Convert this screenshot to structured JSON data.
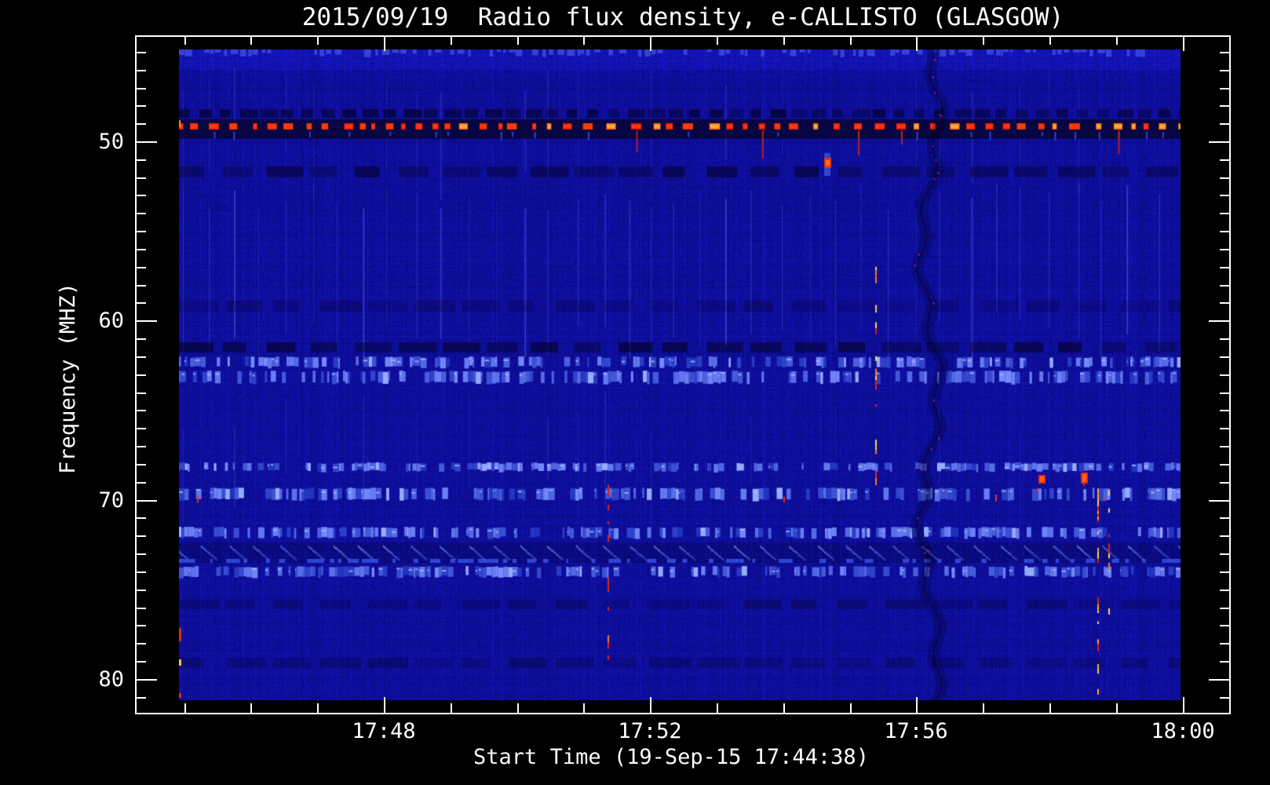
{
  "chart_data": {
    "type": "heatmap",
    "subtype": "radio-spectrogram",
    "title": "2015/09/19  Radio flux density, e-CALLISTO (GLASGOW)",
    "xlabel": "Start Time (19-Sep-15 17:44:38)",
    "ylabel": "Frequency (MHZ)",
    "x_axis": {
      "start_time": "17:44:38",
      "end_time": "18:00:00",
      "minor_tick_step_seconds": 60,
      "first_minor_tick": "17:45",
      "minor_tick_count": 16,
      "major_every_nth": 4,
      "major_labels": [
        "17:48",
        "17:52",
        "17:56",
        "18:00"
      ]
    },
    "y_axis": {
      "unit": "MHz",
      "orientation": "inverted-low-at-top",
      "minor_tick_min": 45,
      "minor_tick_max": 81,
      "minor_tick_step": 1,
      "major_values": [
        50,
        60,
        70,
        80
      ],
      "major_labels": [
        "50",
        "60",
        "70",
        "80"
      ],
      "data_freq_range_mhz": [
        44.9,
        81.3
      ]
    },
    "colormap": {
      "background_low": "#05056e",
      "background_mid": "#0a0a8c",
      "background_high": "#2a3cd2",
      "rfi_strong": "#ff2a00",
      "rfi_saturated": "#ffd24a",
      "frame_and_text": "#ffffff",
      "page_background": "#000000"
    },
    "rfi_bands": [
      {
        "freq_mhz": [
          48.2,
          48.7
        ],
        "type": "dark-dashed"
      },
      {
        "freq_mhz": [
          48.9,
          49.4
        ],
        "type": "strong-red-dashed"
      },
      {
        "freq_mhz": [
          49.5,
          49.9
        ],
        "type": "blue-ticks"
      },
      {
        "freq_mhz": [
          51.4,
          52.0
        ],
        "type": "dark-blocks"
      },
      {
        "freq_mhz": [
          58.9,
          59.5
        ],
        "type": "faint-dark"
      },
      {
        "freq_mhz": [
          61.2,
          61.8
        ],
        "type": "dark-blocks"
      },
      {
        "freq_mhz": [
          62.0,
          62.6
        ],
        "type": "bright-dashed"
      },
      {
        "freq_mhz": [
          62.8,
          63.5
        ],
        "type": "bright-dashed"
      },
      {
        "freq_mhz": [
          67.9,
          68.4
        ],
        "type": "bright-dashed"
      },
      {
        "freq_mhz": [
          69.3,
          70.0
        ],
        "type": "bright-dashed-red"
      },
      {
        "freq_mhz": [
          71.5,
          72.1
        ],
        "type": "bright-dashed"
      },
      {
        "freq_mhz": [
          72.4,
          73.5
        ],
        "type": "diagonal-comb"
      },
      {
        "freq_mhz": [
          73.7,
          74.3
        ],
        "type": "bright-dashed"
      },
      {
        "freq_mhz": [
          75.6,
          76.1
        ],
        "type": "faint-dark"
      },
      {
        "freq_mhz": [
          78.8,
          79.4
        ],
        "type": "faint-dark"
      }
    ],
    "events": [
      {
        "time": "17:51:22",
        "freq_mhz": [
          68.8,
          79.4
        ],
        "type": "red-dashed-streak"
      },
      {
        "time": "17:54:40",
        "freq_mhz": [
          50.9,
          51.4
        ],
        "type": "point-burst"
      },
      {
        "time": "17:55:23",
        "freq_mhz": [
          57.0,
          70.2
        ],
        "type": "orange-dashed-streak"
      },
      {
        "time": "17:56:12",
        "freq_mhz": [
          44.9,
          81.3
        ],
        "type": "dark-disturbance-column"
      },
      {
        "time": "17:57:53",
        "freq_mhz": [
          68.6,
          69.1
        ],
        "type": "red-blob"
      },
      {
        "time": "17:58:31",
        "freq_mhz": [
          68.5,
          69.1
        ],
        "type": "red-blob"
      },
      {
        "time": "17:58:43",
        "freq_mhz": [
          68.8,
          81.1
        ],
        "type": "yellow-dashed-streak"
      },
      {
        "time": "17:58:53",
        "freq_mhz": [
          68.8,
          76.3
        ],
        "type": "orange-dashed-streak"
      }
    ]
  }
}
